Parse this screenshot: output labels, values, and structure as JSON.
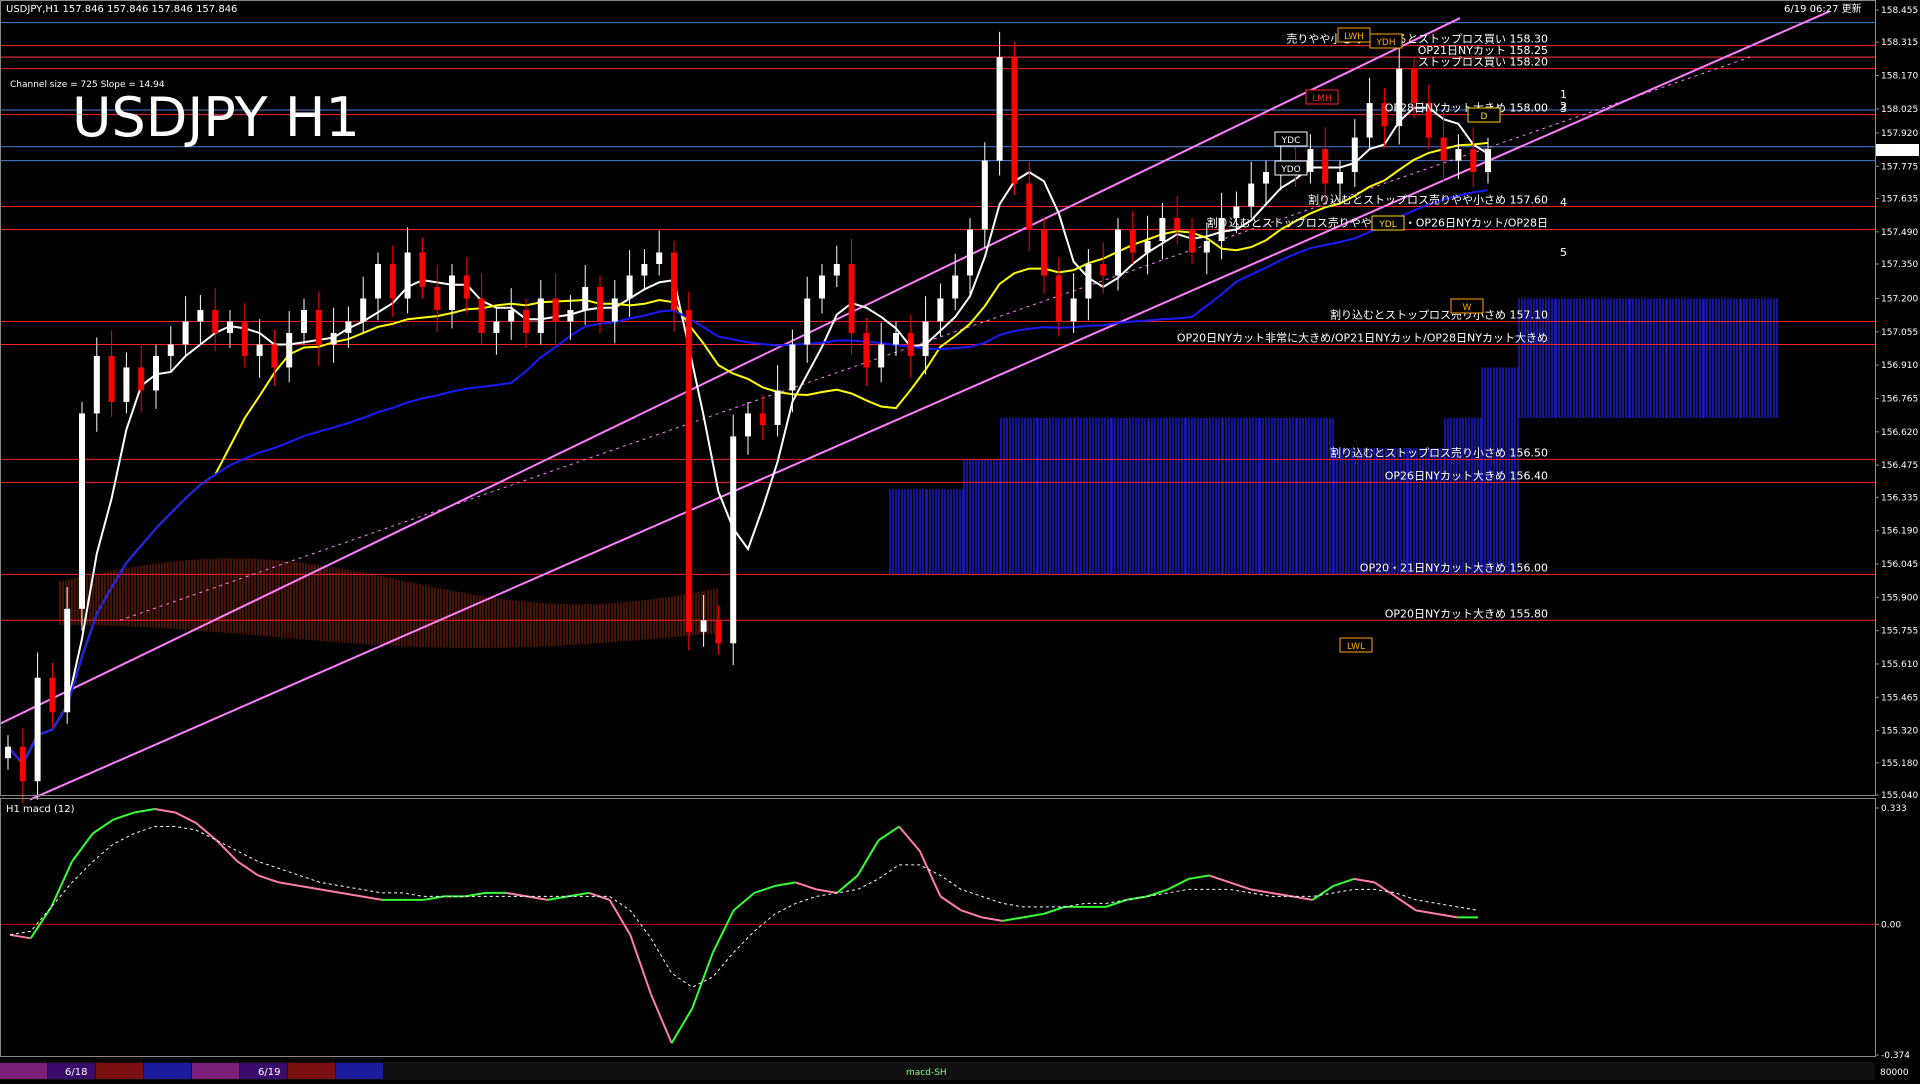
{
  "header": {
    "symbol_info": "USDJPY,H1  157.846 157.846 157.846 157.846",
    "channel_info": "Channel size = 725 Slope = 14.94",
    "big_title": "USDJPY H1",
    "clock": "6/19 06:27 更新"
  },
  "chart_data": [
    {
      "type": "candlestick",
      "title": "USDJPY H1",
      "ylim": [
        155.04,
        158.455
      ],
      "y_ticks": [
        "158.455",
        "158.315",
        "158.170",
        "158.025",
        "157.920",
        "157.775",
        "157.635",
        "157.490",
        "157.350",
        "157.200",
        "157.055",
        "156.910",
        "156.765",
        "156.620",
        "156.475",
        "156.335",
        "156.190",
        "156.045",
        "155.900",
        "155.755",
        "155.610",
        "155.465",
        "155.320",
        "155.180",
        "155.040"
      ],
      "current_price": "157.846",
      "x_labels": [
        "6/18",
        "6/19"
      ],
      "close_path": [
        155.25,
        155.1,
        155.55,
        155.4,
        155.85,
        156.7,
        156.95,
        156.75,
        156.9,
        156.8,
        156.95,
        157.0,
        157.1,
        157.15,
        157.05,
        157.1,
        156.95,
        157.0,
        156.9,
        157.05,
        157.15,
        157.0,
        157.05,
        157.1,
        157.2,
        157.35,
        157.2,
        157.4,
        157.25,
        157.15,
        157.3,
        157.2,
        157.05,
        157.1,
        157.15,
        157.05,
        157.2,
        157.1,
        157.15,
        157.25,
        157.1,
        157.2,
        157.3,
        157.35,
        157.4,
        157.15,
        155.75,
        155.8,
        155.7,
        156.6,
        156.7,
        156.65,
        156.8,
        157.0,
        157.2,
        157.3,
        157.35,
        157.05,
        156.9,
        157.0,
        157.05,
        156.95,
        157.1,
        157.2,
        157.3,
        157.5,
        157.8,
        158.25,
        157.7,
        157.5,
        157.3,
        157.1,
        157.2,
        157.35,
        157.3,
        157.5,
        157.4,
        157.45,
        157.55,
        157.5,
        157.4,
        157.45,
        157.55,
        157.6,
        157.7,
        157.75,
        157.8,
        157.75,
        157.85,
        157.7,
        157.75,
        157.9,
        158.05,
        157.95,
        158.2,
        158.05,
        157.9,
        157.8,
        157.85,
        157.75,
        157.85
      ],
      "horizontal_levels": [
        {
          "price": 158.3,
          "label": "売りやや小さめ・超えるとストップロス買い 158.30"
        },
        {
          "price": 158.25,
          "label": "OP21日NYカット 158.25"
        },
        {
          "price": 158.2,
          "label": "ストップロス買い 158.20"
        },
        {
          "price": 158.0,
          "label": "OP28日NYカット大きめ 158.00"
        },
        {
          "price": 157.6,
          "label": "割り込むとストップロス売りやや小さめ 157.60"
        },
        {
          "price": 157.5,
          "label": "割り込むとストップロス売りやや小さめ・OP26日NYカット/OP28日"
        },
        {
          "price": 157.1,
          "label": "割り込むとストップロス売り小さめ 157.10"
        },
        {
          "price": 157.0,
          "label": "OP20日NYカット非常に大きめ/OP21日NYカット/OP28日NYカット大きめ"
        },
        {
          "price": 156.5,
          "label": "割り込むとストップロス売り小さめ 156.50"
        },
        {
          "price": 156.4,
          "label": "OP26日NYカット大きめ 156.40"
        },
        {
          "price": 156.0,
          "label": "OP20・21日NYカット大きめ 156.00"
        },
        {
          "price": 155.8,
          "label": "OP20日NYカット大きめ 155.80"
        }
      ],
      "markers": {
        "ydc": "YDC",
        "ydo": "YDO",
        "ydl": "YDL",
        "lmh": "LMH",
        "lwh": "LWH",
        "ydh": "YDH",
        "lwl": "LWL",
        "w": "W",
        "d": "D"
      },
      "projection_labels": [
        "1",
        "2",
        "3",
        "4",
        "5"
      ],
      "colors": {
        "bull": "#ffffff",
        "bear": "#ff0000",
        "sma_white": "#ffffff",
        "sma_yellow": "#ffff00",
        "sma_blue": "#1a1aff",
        "channel": "#ff80ff",
        "level": "#ff2020",
        "grid": "#4a7fd4",
        "kumo_blue": "#1a1acd",
        "kumo_red": "#ff4400"
      }
    },
    {
      "type": "line",
      "title": "H1 macd (12)",
      "ylim": [
        -0.374,
        0.333
      ],
      "y_ticks": [
        "0.333",
        "0.00",
        "-0.374"
      ],
      "series": [
        {
          "values": [
            -0.03,
            -0.04,
            0.05,
            0.18,
            0.26,
            0.3,
            0.32,
            0.33,
            0.32,
            0.29,
            0.24,
            0.18,
            0.14,
            0.12,
            0.11,
            0.1,
            0.09,
            0.08,
            0.07,
            0.07,
            0.07,
            0.08,
            0.08,
            0.09,
            0.09,
            0.08,
            0.07,
            0.08,
            0.09,
            0.07,
            -0.03,
            -0.2,
            -0.34,
            -0.24,
            -0.08,
            0.04,
            0.09,
            0.11,
            0.12,
            0.1,
            0.09,
            0.14,
            0.24,
            0.28,
            0.21,
            0.08,
            0.04,
            0.02,
            0.01,
            0.02,
            0.03,
            0.05,
            0.05,
            0.05,
            0.07,
            0.08,
            0.1,
            0.13,
            0.14,
            0.12,
            0.1,
            0.09,
            0.08,
            0.07,
            0.11,
            0.13,
            0.12,
            0.08,
            0.04,
            0.03,
            0.02,
            0.02
          ]
        }
      ],
      "signal_values": [
        -0.03,
        -0.02,
        0.05,
        0.12,
        0.18,
        0.23,
        0.26,
        0.28,
        0.28,
        0.27,
        0.24,
        0.21,
        0.18,
        0.16,
        0.14,
        0.12,
        0.11,
        0.1,
        0.09,
        0.09,
        0.08,
        0.08,
        0.08,
        0.08,
        0.08,
        0.08,
        0.08,
        0.08,
        0.08,
        0.08,
        0.04,
        -0.04,
        -0.14,
        -0.18,
        -0.15,
        -0.08,
        -0.02,
        0.03,
        0.06,
        0.08,
        0.09,
        0.1,
        0.13,
        0.17,
        0.17,
        0.14,
        0.1,
        0.08,
        0.06,
        0.05,
        0.05,
        0.05,
        0.06,
        0.06,
        0.07,
        0.08,
        0.09,
        0.1,
        0.1,
        0.1,
        0.09,
        0.08,
        0.08,
        0.08,
        0.09,
        0.1,
        0.1,
        0.09,
        0.07,
        0.06,
        0.05,
        0.04
      ]
    }
  ],
  "footer": {
    "tab1": "6/18",
    "tab2": "6/19",
    "status": "macd-SH",
    "bottom_right": "80000"
  }
}
